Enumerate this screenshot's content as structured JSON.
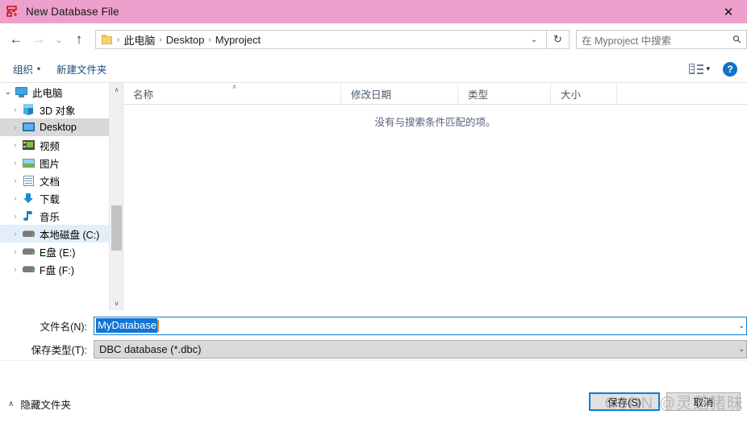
{
  "window": {
    "title": "New Database File",
    "title_icon": "database-table-icon",
    "close_label": "✕",
    "title_bar_color": "#eca0cb"
  },
  "nav": {
    "back_icon": "←",
    "forward_icon": "→",
    "recent_icon": "⌄",
    "up_icon": "↑",
    "breadcrumbs": [
      "此电脑",
      "Desktop",
      "Myproject"
    ],
    "separator": "›",
    "address_dropdown_icon": "⌄",
    "refresh_icon": "↻",
    "search_placeholder": "在 Myproject 中搜索",
    "search_icon": "⚲"
  },
  "command_bar": {
    "organize": "组织",
    "organize_caret": "▾",
    "new_folder": "新建文件夹",
    "view_caret": "▾",
    "help": "?"
  },
  "sidebar": {
    "items": [
      {
        "label": "此电脑",
        "icon": "computer-icon",
        "level": 0,
        "chevron": "⌄",
        "state": "expanded"
      },
      {
        "label": "3D 对象",
        "icon": "3d-objects-icon",
        "level": 1,
        "chevron": "›",
        "state": "normal"
      },
      {
        "label": "Desktop",
        "icon": "desktop-icon",
        "level": 1,
        "chevron": "›",
        "state": "selected-gray"
      },
      {
        "label": "视频",
        "icon": "videos-icon",
        "level": 1,
        "chevron": "›",
        "state": "normal"
      },
      {
        "label": "图片",
        "icon": "pictures-icon",
        "level": 1,
        "chevron": "›",
        "state": "normal"
      },
      {
        "label": "文档",
        "icon": "documents-icon",
        "level": 1,
        "chevron": "›",
        "state": "normal"
      },
      {
        "label": "下载",
        "icon": "downloads-icon",
        "level": 1,
        "chevron": "›",
        "state": "normal"
      },
      {
        "label": "音乐",
        "icon": "music-icon",
        "level": 1,
        "chevron": "›",
        "state": "normal"
      },
      {
        "label": "本地磁盘 (C:)",
        "icon": "drive-icon",
        "level": 1,
        "chevron": "›",
        "state": "selected-blue"
      },
      {
        "label": "E盘 (E:)",
        "icon": "drive-icon",
        "level": 1,
        "chevron": "›",
        "state": "normal"
      },
      {
        "label": "F盘 (F:)",
        "icon": "drive-icon",
        "level": 1,
        "chevron": "›",
        "state": "normal"
      }
    ],
    "scroll_up_icon": "∧",
    "scroll_down_icon": "∨"
  },
  "file_list": {
    "columns": [
      {
        "label": "名称",
        "sorted": true,
        "sort_icon": "∧"
      },
      {
        "label": "修改日期",
        "sorted": false
      },
      {
        "label": "类型",
        "sorted": false
      },
      {
        "label": "大小",
        "sorted": false
      }
    ],
    "empty_message": "没有与搜索条件匹配的项。",
    "rows": []
  },
  "form": {
    "filename_label": "文件名(N):",
    "filename_value": "MyDatabase",
    "filename_selected": true,
    "filetype_label": "保存类型(T):",
    "filetype_value": "DBC database (*.dbc)",
    "dropdown_icon": "⌄"
  },
  "footer": {
    "hide_folders": "隐藏文件夹",
    "hide_folders_icon": "∧",
    "save_button": "保存(S)",
    "cancel_button": "取消",
    "watermark": "CSDN @灵芝猪昧"
  },
  "colors": {
    "accent_blue": "#0a7fd4",
    "selection_blue": "#1175d6",
    "title_pink": "#eca0cb",
    "link_blue": "#1d4a7a"
  }
}
